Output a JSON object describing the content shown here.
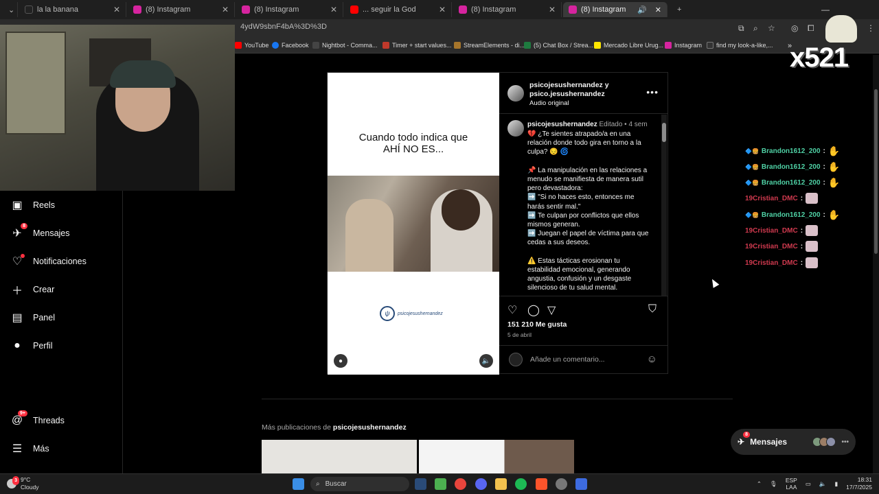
{
  "browser": {
    "tabs": [
      {
        "label": "la la banana",
        "icon": "tiktok-icon",
        "color": "#222222"
      },
      {
        "label": "(8) Instagram",
        "icon": "instagram-icon",
        "color": "#d6249f"
      },
      {
        "label": "(8) Instagram",
        "icon": "instagram-icon",
        "color": "#d6249f"
      },
      {
        "label": "... seguir la God",
        "icon": "youtube-icon",
        "color": "#ff0000"
      },
      {
        "label": "(8) Instagram",
        "icon": "instagram-icon",
        "color": "#d6249f"
      },
      {
        "label": "(8) Instagram",
        "icon": "instagram-icon",
        "color": "#d6249f"
      }
    ],
    "url_fragment": "4ydW9sbnF4bA%3D%3D",
    "bookmarks": [
      {
        "label": "YouTube",
        "color": "#ff0000"
      },
      {
        "label": "Facebook",
        "color": "#1877f2"
      },
      {
        "label": "Nightbot - Comma...",
        "color": "#444444"
      },
      {
        "label": "Timer + start values...",
        "color": "#c0392b"
      },
      {
        "label": "StreamElements - di...",
        "color": "#a6752b"
      },
      {
        "label": "(5) Chat Box / Strea...",
        "color": "#1e7a3f"
      },
      {
        "label": "Mercado Libre Urug...",
        "color": "#ffe600"
      },
      {
        "label": "Instagram",
        "color": "#d6249f"
      },
      {
        "label": "find my look-a-like,...",
        "color": "#333333"
      }
    ]
  },
  "sidebar": {
    "items": [
      {
        "label": "Reels",
        "icon": "reels-icon"
      },
      {
        "label": "Mensajes",
        "icon": "messenger-icon",
        "badge": "8"
      },
      {
        "label": "Notificaciones",
        "icon": "heart-icon",
        "dot": true
      },
      {
        "label": "Crear",
        "icon": "plus-icon"
      },
      {
        "label": "Panel",
        "icon": "dashboard-icon"
      },
      {
        "label": "Perfil",
        "icon": "profile-icon"
      },
      {
        "label": "Threads",
        "icon": "threads-icon",
        "badge": "9+"
      },
      {
        "label": "Más",
        "icon": "menu-icon"
      }
    ]
  },
  "post": {
    "media_caption": "Cuando todo indica que\nAHÍ NO ES...",
    "media_watermark": "psicojesushernandez",
    "header_line1": "psicojesushernandez y",
    "header_line2": "psico.jesushernandez",
    "audio": "Audio original",
    "caption_user": "psicojesushernandez",
    "caption_meta": "Editado • 4 sem",
    "caption_lines": [
      "💔 ¿Te sientes atrapado/a en una",
      "relación donde todo gira en torno a la",
      "culpa? 😔 🌀",
      "",
      "📌 La manipulación en las relaciones a",
      "menudo se manifiesta de manera sutil",
      "pero devastadora:",
      "➡️ \"Si no haces esto, entonces me",
      "harás sentir mal.\"",
      "➡️ Te culpan por conflictos que ellos",
      "mismos generan.",
      "➡️ Juegan el papel de víctima para que",
      "cedas a sus deseos.",
      "",
      "⚠️ Estas tácticas erosionan tu",
      "estabilidad emocional, generando",
      "angustia, confusión y un desgaste",
      "silencioso de tu salud mental."
    ],
    "likes": "151 210 Me gusta",
    "date": "5 de abril",
    "comment_placeholder": "Añade un comentario..."
  },
  "more_posts": {
    "prefix": "Más publicaciones de",
    "user": "psicojesushernandez"
  },
  "chat": [
    {
      "user": "Brandon1612_200",
      "color": "#4fd1a5"
    },
    {
      "user": "Brandon1612_200",
      "color": "#4fd1a5"
    },
    {
      "user": "Brandon1612_200",
      "color": "#4fd1a5"
    },
    {
      "user": "19Cristian_DMC",
      "color": "#d13a4f"
    },
    {
      "user": "Brandon1612_200",
      "color": "#4fd1a5"
    },
    {
      "user": "19Cristian_DMC",
      "color": "#d13a4f"
    },
    {
      "user": "19Cristian_DMC",
      "color": "#d13a4f"
    },
    {
      "user": "19Cristian_DMC",
      "color": "#d13a4f"
    }
  ],
  "overlay_counter": "x521",
  "messages_pill": {
    "label": "Mensajes",
    "badge": "8"
  },
  "taskbar": {
    "temp": "9°C",
    "weather": "Cloudy",
    "weather_badge": "3",
    "search_placeholder": "Buscar",
    "lang1": "ESP",
    "lang2": "LAA",
    "time": "18:31",
    "date": "17/7/2025"
  }
}
